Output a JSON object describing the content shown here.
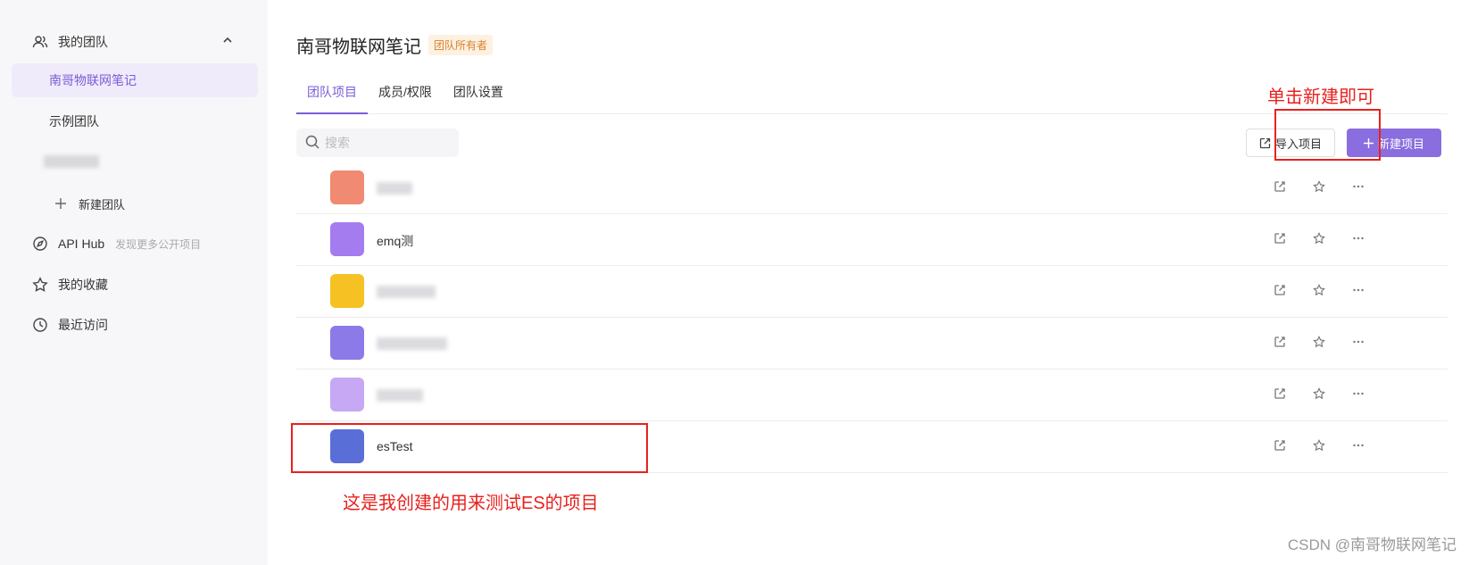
{
  "sidebar": {
    "my_team_label": "我的团队",
    "teams": [
      {
        "label": "南哥物联网笔记",
        "active": true
      },
      {
        "label": "示例团队",
        "active": false
      },
      {
        "label": "",
        "active": false
      }
    ],
    "new_team_label": "新建团队",
    "api_hub_label": "API Hub",
    "api_hub_sub": "发现更多公开项目",
    "favorites_label": "我的收藏",
    "recent_label": "最近访问"
  },
  "main": {
    "team_title": "南哥物联网笔记",
    "owner_badge": "团队所有者",
    "tabs": [
      "团队项目",
      "成员/权限",
      "团队设置"
    ],
    "search_placeholder": "搜索",
    "import_label": "导入项目",
    "new_project_label": "新建项目",
    "projects": [
      {
        "name": "",
        "avatar_color": "#f08a72"
      },
      {
        "name": "emq测",
        "avatar_color": "#a57bf0"
      },
      {
        "name": "",
        "avatar_color": "#f6c223"
      },
      {
        "name": "",
        "avatar_color": "#8b7ae8"
      },
      {
        "name": "",
        "avatar_color": "#c6a8f5"
      },
      {
        "name": "esTest",
        "avatar_color": "#5a6ed8"
      }
    ]
  },
  "annotations": {
    "click_new": "单击新建即可",
    "es_project": "这是我创建的用来测试ES的项目"
  },
  "watermark": "CSDN @南哥物联网笔记",
  "colors": {
    "accent": "#7a5cd6",
    "annotation": "#e8211d"
  }
}
